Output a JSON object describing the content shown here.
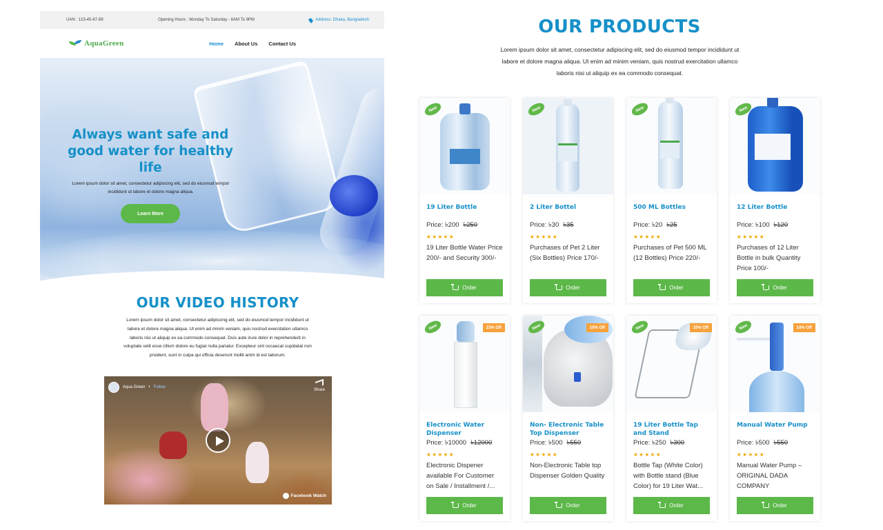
{
  "topbar": {
    "uan": "UAN : 123-45-67-89",
    "hours": "Opening Hours : Monday To Saturday - 8AM To 9PM",
    "address": "Address: Dhaka, Bangladesh"
  },
  "brand": {
    "logo_text": "AquaGreen"
  },
  "nav": {
    "items": [
      "Home",
      "About Us",
      "Contact Us"
    ]
  },
  "hero": {
    "heading": "Always want safe and good water for healthy life",
    "text": "Lorem ipsum dolor sit amet, consectetur adipiscing elit, sed do eiusmod tempor incididunt ut labore et dolore magna aliqua.",
    "button": "Learn More"
  },
  "video": {
    "title": "OUR VIDEO HISTORY",
    "description": "Lorem ipsum dolor sit amet, consectetur adipiscing elit, sed do eiusmod tempor incididunt ut labore et dolore magna aliqua. Ut enim ad minim veniam, quis nostrud exercitation ullamco laboris nisi ut aliquip ex ea commodo consequat. Duis aute irure dolor in reprehenderit in voluptate velit esse cillum dolore eu fugiat nulla pariatur. Excepteur sint occaecat cupidatat non proident, sunt in culpa qui officia deserunt mollit anim id est laborum.",
    "page_name": "Aqua Green",
    "follow": "Follow",
    "share": "Share",
    "watch": "Facebook Watch"
  },
  "products": {
    "title": "OUR PRODUCTS",
    "description": "Lorem ipsum dolor sit amet, consectetur adipiscing elit, sed do eiusmod tempor incididunt ut labore et dolore magna aliqua. Ut enim ad minim veniam, quis nostrud exercitation ullamco laboris nisi ut aliquip ex ea commodo consequat.",
    "order_label": "Order",
    "new_label": "New",
    "stars": "★★★★★",
    "items": [
      {
        "name": "19 Liter Bottle",
        "price": "Price: ৳200",
        "old_price": "৳250",
        "desc": "19 Liter Bottle Water Price 200/- and Security 300/-",
        "off": ""
      },
      {
        "name": "2 Liter Bottel",
        "price": "Price: ৳30",
        "old_price": "৳35",
        "desc": "Purchases of Pet 2 Liter (Six Bottles) Price 170/-",
        "off": ""
      },
      {
        "name": "500 ML Bottles",
        "price": "Price: ৳20",
        "old_price": "৳25",
        "desc": "Purchases of Pet 500 ML (12 Bottles) Price 220/-",
        "off": ""
      },
      {
        "name": "12 Liter Bottle",
        "price": "Price: ৳100",
        "old_price": "৳120",
        "desc": "Purchases of 12 Liter Bottle in bulk Quantity Price 100/-",
        "off": ""
      },
      {
        "name": "Electronic Water Dispenser",
        "price": "Price: ৳10000",
        "old_price": "৳12000",
        "desc": "Electronic Dispener available For Customer on Sale / Installment /...",
        "off": "15% Off"
      },
      {
        "name": "Non- Electronic Table Top Dispenser",
        "price": "Price: ৳500",
        "old_price": "৳550",
        "desc": "Non-Electronic Table top Dispenser Golden Quality",
        "off": "10% Off"
      },
      {
        "name": "19 Liter Bottle Tap and Stand",
        "price": "Price: ৳250",
        "old_price": "৳300",
        "desc": "Bottle Tap (White Color) with Bottle stand (Blue Color) for 19 Liter Wat...",
        "off": "10% Off"
      },
      {
        "name": "Manual Water Pump",
        "price": "Price: ৳500",
        "old_price": "৳550",
        "desc": "Manual Water Pump – ORIGINAL DADA COMPANY",
        "off": "10% Off"
      }
    ]
  }
}
